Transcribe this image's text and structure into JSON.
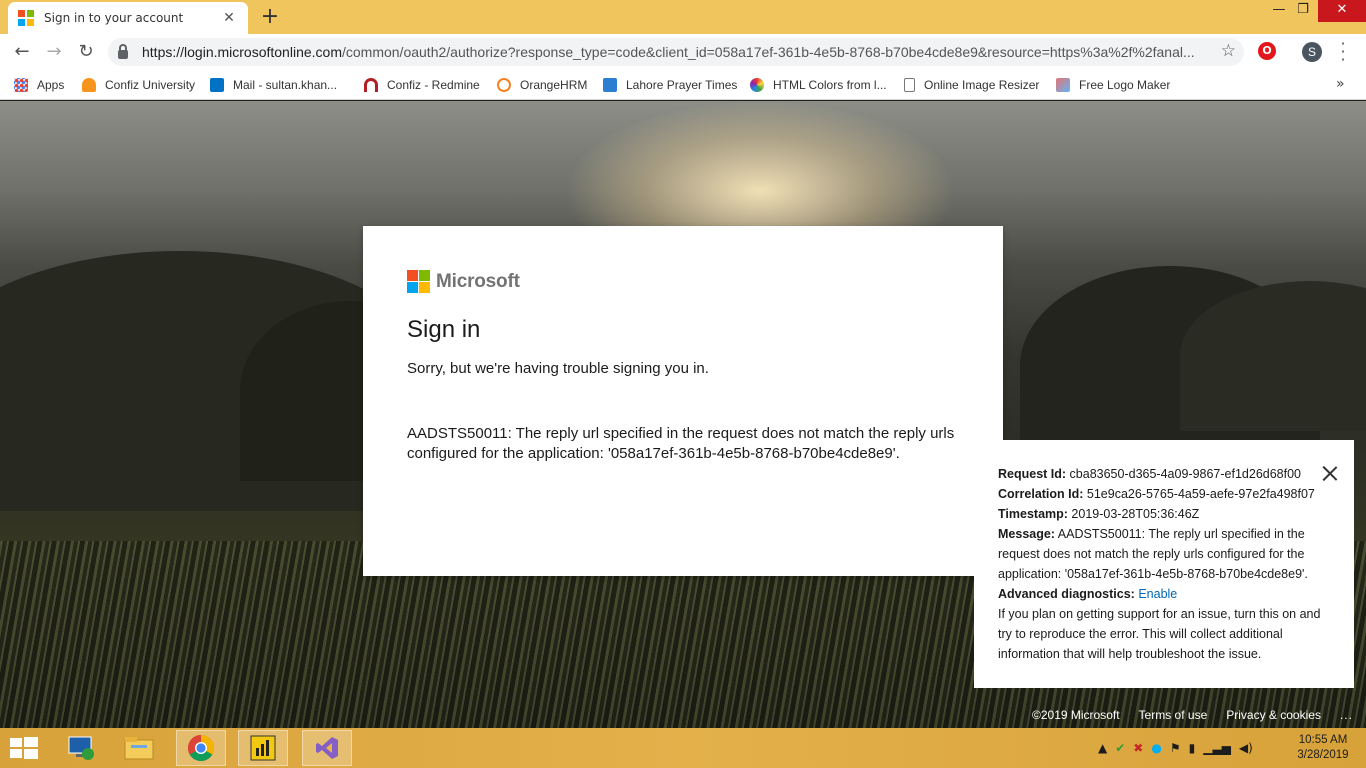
{
  "browser": {
    "tab_title": "Sign in to your account",
    "tab_close": "✕",
    "new_tab": "+",
    "window_controls": {
      "minimize": "—",
      "maximize": "❐",
      "close": "✕"
    },
    "url_host": "https://login.microsoftonline.com",
    "url_rest": "/common/oauth2/authorize?response_type=code&client_id=058a17ef-361b-4e5b-8768-b70be4cde8e9&resource=https%3a%2f%2fanal...",
    "profile_initial": "S",
    "extension_label": "O",
    "bookmarks": [
      {
        "label": "Apps",
        "icon": "apps-grid-icon",
        "color": "#4285f4"
      },
      {
        "label": "Confiz University",
        "icon": "confiz-icon",
        "color": "#f7941d"
      },
      {
        "label": "Mail - sultan.khan...",
        "icon": "outlook-icon",
        "color": "#0072c6"
      },
      {
        "label": "Confiz - Redmine",
        "icon": "redmine-icon",
        "color": "#b32024"
      },
      {
        "label": "OrangeHRM",
        "icon": "orangehrm-icon",
        "color": "#f58220"
      },
      {
        "label": "Lahore Prayer Times",
        "icon": "prayer-icon",
        "color": "#2d7dd2"
      },
      {
        "label": "HTML Colors from l...",
        "icon": "color-wheel-icon",
        "color": "#e53935"
      },
      {
        "label": "Online Image Resizer",
        "icon": "page-icon",
        "color": "#888888"
      },
      {
        "label": "Free Logo Maker",
        "icon": "logo-maker-icon",
        "color": "#e57373"
      }
    ],
    "bookmarks_more": "»"
  },
  "signin": {
    "brand": "Microsoft",
    "brand_colors": [
      "#f25022",
      "#7fba00",
      "#00a4ef",
      "#ffb900"
    ],
    "title": "Sign in",
    "subtitle": "Sorry, but we're having trouble signing you in.",
    "error": "AADSTS50011: The reply url specified in the request does not match the reply urls configured for the application: '058a17ef-361b-4e5b-8768-b70be4cde8e9'."
  },
  "details": {
    "request_id_label": "Request Id:",
    "request_id": "cba83650-d365-4a09-9867-ef1d26d68f00",
    "correlation_id_label": "Correlation Id:",
    "correlation_id": "51e9ca26-5765-4a59-aefe-97e2fa498f07",
    "timestamp_label": "Timestamp:",
    "timestamp": "2019-03-28T05:36:46Z",
    "message_label": "Message:",
    "message": "AADSTS50011: The reply url specified in the request does not match the reply urls configured for the application: '058a17ef-361b-4e5b-8768-b70be4cde8e9'.",
    "advanced_label": "Advanced diagnostics:",
    "advanced_link": "Enable",
    "advanced_help": "If you plan on getting support for an issue, turn this on and try to reproduce the error. This will collect additional information that will help troubleshoot the issue."
  },
  "footer": {
    "copyright": "©2019 Microsoft",
    "terms": "Terms of use",
    "privacy": "Privacy & cookies",
    "more": "..."
  },
  "taskbar": {
    "time": "10:55 AM",
    "date": "3/28/2019",
    "apps": [
      "remote-desktop-icon",
      "file-explorer-icon",
      "chrome-icon",
      "power-bi-icon",
      "visual-studio-icon"
    ]
  }
}
